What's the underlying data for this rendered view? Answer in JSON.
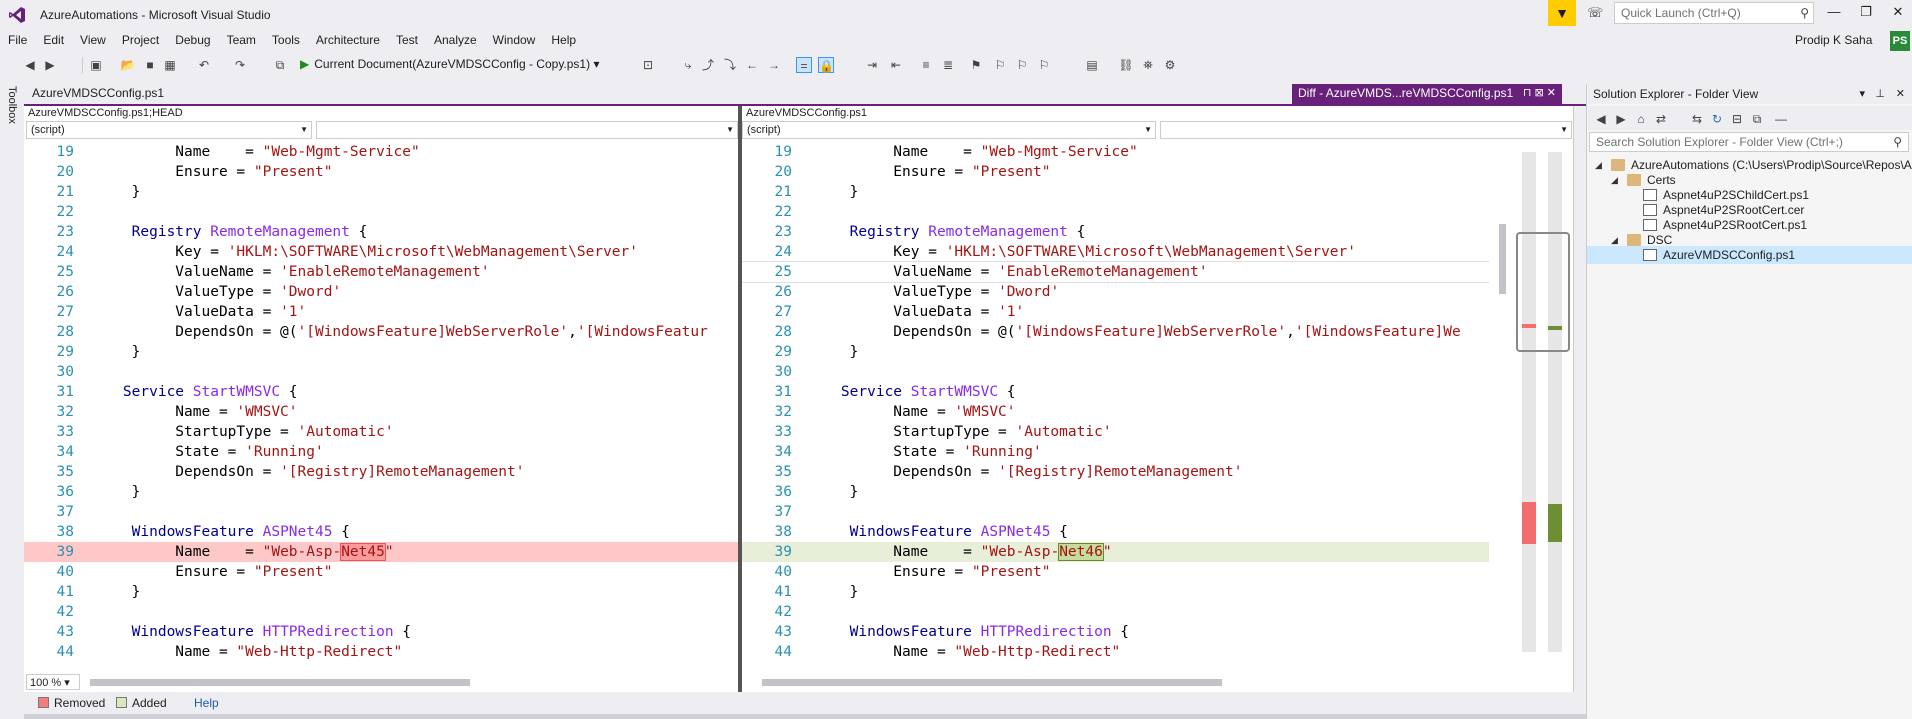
{
  "window": {
    "title": "AzureAutomations - Microsoft Visual Studio",
    "quick_launch_placeholder": "Quick Launch (Ctrl+Q)"
  },
  "menu": [
    "File",
    "Edit",
    "View",
    "Project",
    "Debug",
    "Team",
    "Tools",
    "Architecture",
    "Test",
    "Analyze",
    "Window",
    "Help"
  ],
  "user": {
    "name": "Prodip K Saha",
    "initials": "PS"
  },
  "toolbar": {
    "debug_target": "Current Document(AzureVMDSCConfig - Copy.ps1)"
  },
  "toolbox_label": "Toolbox",
  "tabs": {
    "left_tab": "AzureVMDSCConfig.ps1",
    "diff_tab": "Diff - AzureVMDS...reVMDSCConfig.ps1"
  },
  "left_pane": {
    "path": "AzureVMDSCConfig.ps1;HEAD",
    "scope": "(script)",
    "zoom": "100 %"
  },
  "right_pane": {
    "path": "AzureVMDSCConfig.ps1",
    "scope": "(script)"
  },
  "legend": {
    "removed": "Removed",
    "added": "Added",
    "help": "Help"
  },
  "solution_explorer": {
    "title": "Solution Explorer - Folder View",
    "search_placeholder": "Search Solution Explorer - Folder View (Ctrl+;)",
    "tree": [
      {
        "label": "AzureAutomations (C:\\Users\\Prodip\\Source\\Repos\\A",
        "depth": 0,
        "type": "folder",
        "expanded": true
      },
      {
        "label": "Certs",
        "depth": 1,
        "type": "folder",
        "expanded": true
      },
      {
        "label": "Aspnet4uP2SChildCert.ps1",
        "depth": 2,
        "type": "file"
      },
      {
        "label": "Aspnet4uP2SRootCert.cer",
        "depth": 2,
        "type": "file"
      },
      {
        "label": "Aspnet4uP2SRootCert.ps1",
        "depth": 2,
        "type": "file"
      },
      {
        "label": "DSC",
        "depth": 1,
        "type": "folder",
        "expanded": true
      },
      {
        "label": "AzureVMDSCConfig.ps1",
        "depth": 2,
        "type": "file",
        "selected": true
      }
    ]
  },
  "colors": {
    "accent": "#68217a",
    "removed": "#ffc8c8",
    "added": "#e8efd9",
    "filter": "#ffcc00"
  },
  "code_left": [
    {
      "n": "19",
      "segs": [
        [
          "pl",
          "          Name    = "
        ],
        [
          "str",
          "\"Web-Mgmt-Service\""
        ]
      ]
    },
    {
      "n": "20",
      "segs": [
        [
          "pl",
          "          Ensure = "
        ],
        [
          "str",
          "\"Present\""
        ]
      ]
    },
    {
      "n": "21",
      "segs": [
        [
          "pl",
          "     }"
        ]
      ]
    },
    {
      "n": "22",
      "segs": []
    },
    {
      "n": "23",
      "segs": [
        [
          "kw",
          "     Registry "
        ],
        [
          "typ",
          "RemoteManagement"
        ],
        [
          "pl",
          " {"
        ]
      ]
    },
    {
      "n": "24",
      "segs": [
        [
          "pl",
          "          Key = "
        ],
        [
          "str",
          "'HKLM:\\SOFTWARE\\Microsoft\\WebManagement\\Server'"
        ]
      ]
    },
    {
      "n": "25",
      "segs": [
        [
          "pl",
          "          ValueName = "
        ],
        [
          "str",
          "'EnableRemoteManagement'"
        ]
      ]
    },
    {
      "n": "26",
      "segs": [
        [
          "pl",
          "          ValueType = "
        ],
        [
          "str",
          "'Dword'"
        ]
      ]
    },
    {
      "n": "27",
      "segs": [
        [
          "pl",
          "          ValueData = "
        ],
        [
          "str",
          "'1'"
        ]
      ]
    },
    {
      "n": "28",
      "segs": [
        [
          "pl",
          "          DependsOn = @("
        ],
        [
          "str",
          "'[WindowsFeature]WebServerRole'"
        ],
        [
          "pl",
          ","
        ],
        [
          "str",
          "'[WindowsFeatur"
        ]
      ]
    },
    {
      "n": "29",
      "segs": [
        [
          "pl",
          "     }"
        ]
      ]
    },
    {
      "n": "30",
      "segs": []
    },
    {
      "n": "31",
      "segs": [
        [
          "kw",
          "    Service "
        ],
        [
          "typ",
          "StartWMSVC"
        ],
        [
          "pl",
          " {"
        ]
      ]
    },
    {
      "n": "32",
      "segs": [
        [
          "pl",
          "          Name = "
        ],
        [
          "str",
          "'WMSVC'"
        ]
      ]
    },
    {
      "n": "33",
      "segs": [
        [
          "pl",
          "          StartupType = "
        ],
        [
          "str",
          "'Automatic'"
        ]
      ]
    },
    {
      "n": "34",
      "segs": [
        [
          "pl",
          "          State = "
        ],
        [
          "str",
          "'Running'"
        ]
      ]
    },
    {
      "n": "35",
      "segs": [
        [
          "pl",
          "          DependsOn = "
        ],
        [
          "str",
          "'[Registry]RemoteManagement'"
        ]
      ]
    },
    {
      "n": "36",
      "segs": [
        [
          "pl",
          "     }"
        ]
      ]
    },
    {
      "n": "37",
      "segs": []
    },
    {
      "n": "38",
      "segs": [
        [
          "kw",
          "     WindowsFeature "
        ],
        [
          "typ",
          "ASPNet45"
        ],
        [
          "pl",
          " {"
        ]
      ]
    },
    {
      "n": "39",
      "diff": "removed",
      "segs": [
        [
          "pl",
          "          Name    = "
        ],
        [
          "str",
          "\"Web-Asp-"
        ],
        [
          "hlrem",
          "Net45"
        ],
        [
          "str",
          "\""
        ]
      ]
    },
    {
      "n": "40",
      "segs": [
        [
          "pl",
          "          Ensure = "
        ],
        [
          "str",
          "\"Present\""
        ]
      ]
    },
    {
      "n": "41",
      "segs": [
        [
          "pl",
          "     }"
        ]
      ]
    },
    {
      "n": "42",
      "segs": []
    },
    {
      "n": "43",
      "segs": [
        [
          "kw",
          "     WindowsFeature "
        ],
        [
          "typ",
          "HTTPRedirection"
        ],
        [
          "pl",
          " {"
        ]
      ]
    },
    {
      "n": "44",
      "segs": [
        [
          "pl",
          "          Name = "
        ],
        [
          "str",
          "\"Web-Http-Redirect\""
        ]
      ]
    }
  ],
  "code_right": [
    {
      "n": "19",
      "segs": [
        [
          "pl",
          "          Name    = "
        ],
        [
          "str",
          "\"Web-Mgmt-Service\""
        ]
      ]
    },
    {
      "n": "20",
      "segs": [
        [
          "pl",
          "          Ensure = "
        ],
        [
          "str",
          "\"Present\""
        ]
      ]
    },
    {
      "n": "21",
      "segs": [
        [
          "pl",
          "     }"
        ]
      ]
    },
    {
      "n": "22",
      "segs": []
    },
    {
      "n": "23",
      "segs": [
        [
          "kw",
          "     Registry "
        ],
        [
          "typ",
          "RemoteManagement"
        ],
        [
          "pl",
          " {"
        ]
      ]
    },
    {
      "n": "24",
      "segs": [
        [
          "pl",
          "          Key = "
        ],
        [
          "str",
          "'HKLM:\\SOFTWARE\\Microsoft\\WebManagement\\Server'"
        ]
      ]
    },
    {
      "n": "25",
      "caret": true,
      "segs": [
        [
          "pl",
          "          ValueName = "
        ],
        [
          "str",
          "'EnableRemoteManagement'"
        ]
      ]
    },
    {
      "n": "26",
      "segs": [
        [
          "pl",
          "          ValueType = "
        ],
        [
          "str",
          "'Dword'"
        ]
      ]
    },
    {
      "n": "27",
      "segs": [
        [
          "pl",
          "          ValueData = "
        ],
        [
          "str",
          "'1'"
        ]
      ]
    },
    {
      "n": "28",
      "segs": [
        [
          "pl",
          "          DependsOn = @("
        ],
        [
          "str",
          "'[WindowsFeature]WebServerRole'"
        ],
        [
          "pl",
          ","
        ],
        [
          "str",
          "'[WindowsFeature]We"
        ]
      ]
    },
    {
      "n": "29",
      "segs": [
        [
          "pl",
          "     }"
        ]
      ]
    },
    {
      "n": "30",
      "segs": []
    },
    {
      "n": "31",
      "segs": [
        [
          "kw",
          "    Service "
        ],
        [
          "typ",
          "StartWMSVC"
        ],
        [
          "pl",
          " {"
        ]
      ]
    },
    {
      "n": "32",
      "segs": [
        [
          "pl",
          "          Name = "
        ],
        [
          "str",
          "'WMSVC'"
        ]
      ]
    },
    {
      "n": "33",
      "segs": [
        [
          "pl",
          "          StartupType = "
        ],
        [
          "str",
          "'Automatic'"
        ]
      ]
    },
    {
      "n": "34",
      "segs": [
        [
          "pl",
          "          State = "
        ],
        [
          "str",
          "'Running'"
        ]
      ]
    },
    {
      "n": "35",
      "segs": [
        [
          "pl",
          "          DependsOn = "
        ],
        [
          "str",
          "'[Registry]RemoteManagement'"
        ]
      ]
    },
    {
      "n": "36",
      "segs": [
        [
          "pl",
          "     }"
        ]
      ]
    },
    {
      "n": "37",
      "segs": []
    },
    {
      "n": "38",
      "segs": [
        [
          "kw",
          "     WindowsFeature "
        ],
        [
          "typ",
          "ASPNet45"
        ],
        [
          "pl",
          " {"
        ]
      ]
    },
    {
      "n": "39",
      "diff": "added",
      "segs": [
        [
          "pl",
          "          Name    = "
        ],
        [
          "str",
          "\"Web-Asp-"
        ],
        [
          "hladd",
          "Net46"
        ],
        [
          "str",
          "\""
        ]
      ]
    },
    {
      "n": "40",
      "segs": [
        [
          "pl",
          "          Ensure = "
        ],
        [
          "str",
          "\"Present\""
        ]
      ]
    },
    {
      "n": "41",
      "segs": [
        [
          "pl",
          "     }"
        ]
      ]
    },
    {
      "n": "42",
      "segs": []
    },
    {
      "n": "43",
      "segs": [
        [
          "kw",
          "     WindowsFeature "
        ],
        [
          "typ",
          "HTTPRedirection"
        ],
        [
          "pl",
          " {"
        ]
      ]
    },
    {
      "n": "44",
      "segs": [
        [
          "pl",
          "          Name = "
        ],
        [
          "str",
          "\"Web-Http-Redirect\""
        ]
      ]
    }
  ]
}
